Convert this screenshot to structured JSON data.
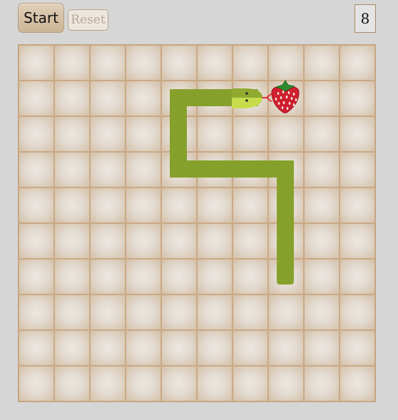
{
  "controls": {
    "start_label": "Start",
    "reset_label": "Reset"
  },
  "score": {
    "value": "8"
  },
  "board": {
    "cols": 10,
    "rows": 10,
    "snake_color": "#86a12b",
    "snake_head_color": "#c7dc4b",
    "tongue_color": "#e0303a",
    "snake_head": {
      "col": 6,
      "row": 1,
      "facing": "right"
    },
    "snake_body": [
      {
        "col": 5,
        "row": 1
      },
      {
        "col": 4,
        "row": 1
      },
      {
        "col": 4,
        "row": 2
      },
      {
        "col": 4,
        "row": 3
      },
      {
        "col": 5,
        "row": 3
      },
      {
        "col": 6,
        "row": 3
      },
      {
        "col": 7,
        "row": 3
      },
      {
        "col": 7,
        "row": 4
      },
      {
        "col": 7,
        "row": 5
      },
      {
        "col": 7,
        "row": 6
      }
    ],
    "food": {
      "col": 7,
      "row": 1,
      "type": "strawberry-icon"
    }
  }
}
